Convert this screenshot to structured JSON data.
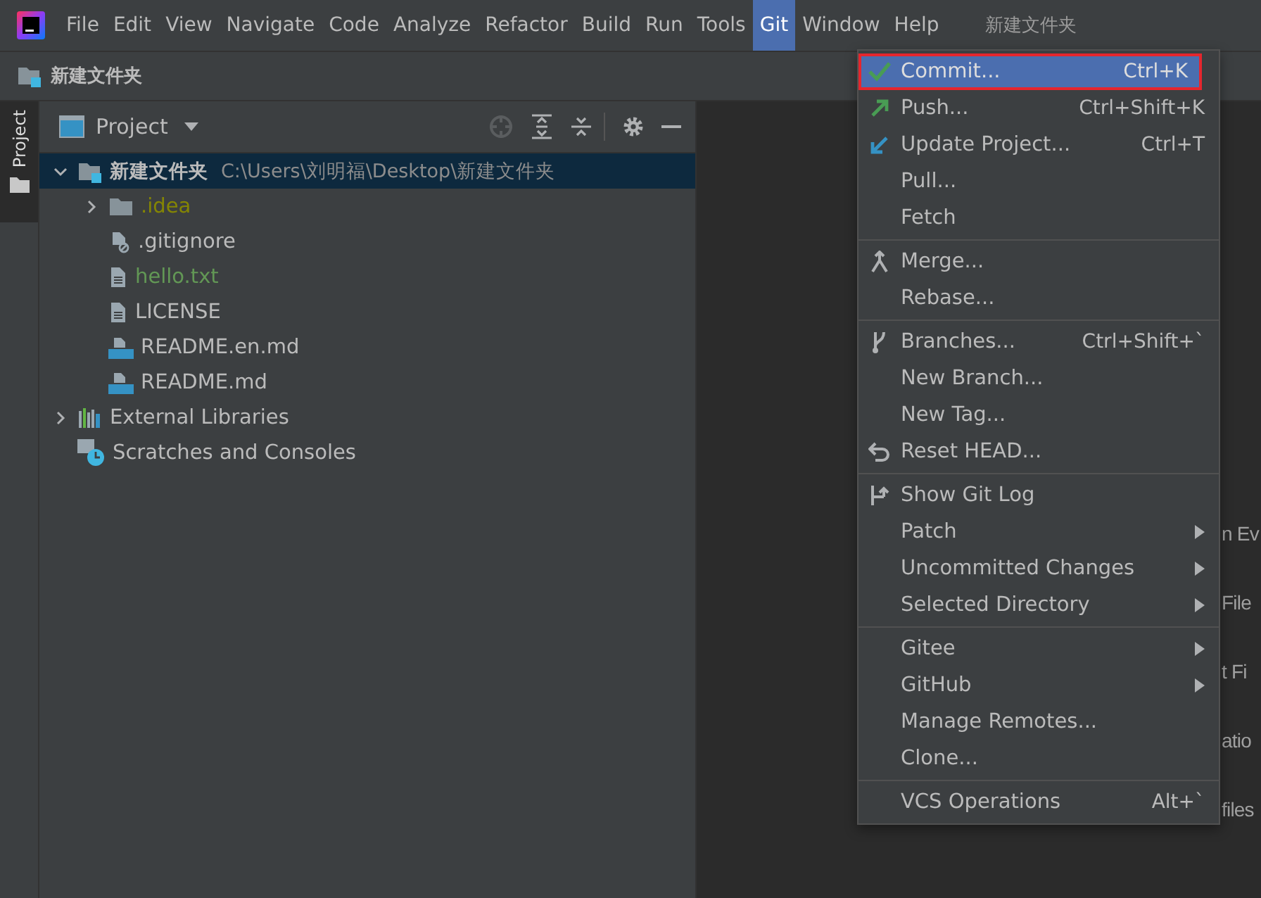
{
  "menubar": {
    "items": [
      {
        "label": "File",
        "selected": false
      },
      {
        "label": "Edit",
        "selected": false
      },
      {
        "label": "View",
        "selected": false
      },
      {
        "label": "Navigate",
        "selected": false
      },
      {
        "label": "Code",
        "selected": false
      },
      {
        "label": "Analyze",
        "selected": false
      },
      {
        "label": "Refactor",
        "selected": false
      },
      {
        "label": "Build",
        "selected": false
      },
      {
        "label": "Run",
        "selected": false
      },
      {
        "label": "Tools",
        "selected": false
      },
      {
        "label": "Git",
        "selected": true
      },
      {
        "label": "Window",
        "selected": false
      },
      {
        "label": "Help",
        "selected": false
      }
    ],
    "title": "新建文件夹"
  },
  "breadcrumb": "新建文件夹",
  "side_tab": {
    "label": "Project"
  },
  "project_panel": {
    "title": "Project",
    "tree": [
      {
        "name": "新建文件夹",
        "path": "C:\\Users\\刘明福\\Desktop\\新建文件夹",
        "kind": "root",
        "expanded": true,
        "selected": true,
        "children": [
          {
            "name": ".idea",
            "kind": "folder",
            "color": "#848504",
            "expanded": false,
            "selected": false
          },
          {
            "name": ".gitignore",
            "kind": "ignorefile",
            "color": "#bbbbbb",
            "selected": false
          },
          {
            "name": "hello.txt",
            "kind": "text",
            "color": "#629755",
            "selected": false
          },
          {
            "name": "LICENSE",
            "kind": "text",
            "color": "#bbbbbb",
            "selected": false
          },
          {
            "name": "README.en.md",
            "kind": "markdown",
            "color": "#bbbbbb",
            "selected": false
          },
          {
            "name": "README.md",
            "kind": "markdown",
            "color": "#bbbbbb",
            "selected": false
          }
        ]
      },
      {
        "name": "External Libraries",
        "kind": "libraries",
        "expanded": false,
        "selected": false
      },
      {
        "name": "Scratches and Consoles",
        "kind": "scratches",
        "selected": false
      }
    ]
  },
  "editor_hints": [
    "n Ev",
    "File",
    "t Fi",
    "atio",
    "files"
  ],
  "git_menu": {
    "groups": [
      [
        {
          "label": "Commit...",
          "shortcut": "Ctrl+K",
          "kind": "check",
          "selected": true,
          "submenu": false
        },
        {
          "label": "Push...",
          "shortcut": "Ctrl+Shift+K",
          "kind": "push",
          "selected": false,
          "submenu": false
        },
        {
          "label": "Update Project...",
          "shortcut": "Ctrl+T",
          "kind": "update",
          "selected": false,
          "submenu": false
        },
        {
          "label": "Pull...",
          "selected": false,
          "submenu": false
        },
        {
          "label": "Fetch",
          "selected": false,
          "submenu": false
        }
      ],
      [
        {
          "label": "Merge...",
          "kind": "merge",
          "selected": false,
          "submenu": false
        },
        {
          "label": "Rebase...",
          "selected": false,
          "submenu": false
        }
      ],
      [
        {
          "label": "Branches...",
          "shortcut": "Ctrl+Shift+`",
          "kind": "branch",
          "selected": false,
          "submenu": false
        },
        {
          "label": "New Branch...",
          "selected": false,
          "submenu": false
        },
        {
          "label": "New Tag...",
          "selected": false,
          "submenu": false
        },
        {
          "label": "Reset HEAD...",
          "kind": "reset",
          "selected": false,
          "submenu": false
        }
      ],
      [
        {
          "label": "Show Git Log",
          "kind": "log",
          "selected": false,
          "submenu": false
        },
        {
          "label": "Patch",
          "selected": false,
          "submenu": true
        },
        {
          "label": "Uncommitted Changes",
          "selected": false,
          "submenu": true
        },
        {
          "label": "Selected Directory",
          "selected": false,
          "submenu": true
        }
      ],
      [
        {
          "label": "Gitee",
          "selected": false,
          "submenu": true
        },
        {
          "label": "GitHub",
          "selected": false,
          "submenu": true
        },
        {
          "label": "Manage Remotes...",
          "selected": false,
          "submenu": false
        },
        {
          "label": "Clone...",
          "selected": false,
          "submenu": false
        }
      ],
      [
        {
          "label": "VCS Operations",
          "shortcut": "Alt+`",
          "selected": false,
          "submenu": false
        }
      ]
    ]
  }
}
